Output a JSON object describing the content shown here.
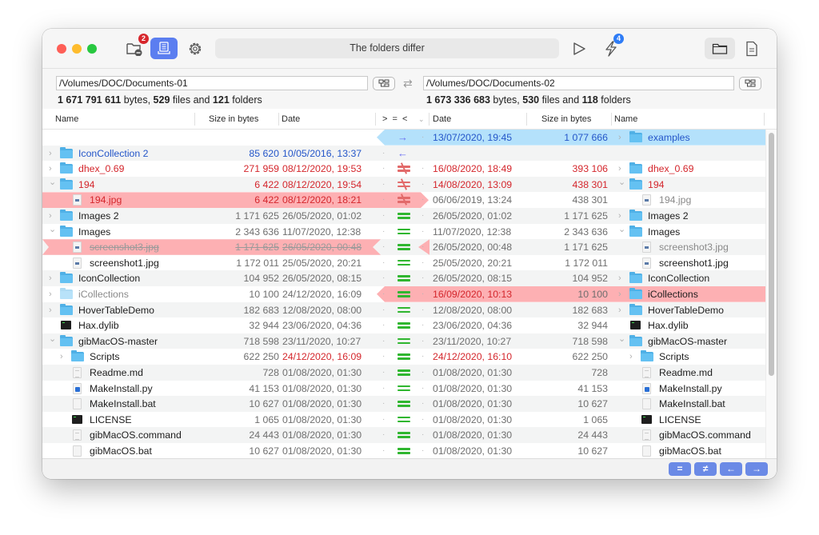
{
  "toolbar": {
    "status_text": "The folders differ",
    "badges": {
      "folder_badge": "2",
      "bolt_badge": "4"
    },
    "icons": [
      "folder-minus-icon",
      "document-compare-icon",
      "gear-icon",
      "play-icon",
      "bolt-icon",
      "folder-view-icon",
      "file-view-icon"
    ]
  },
  "left": {
    "path": "/Volumes/DOC/Documents-01",
    "bytes": "1 671 791 611",
    "files": "529",
    "folders": "121",
    "bytes_label": " bytes, ",
    "files_label": " files and ",
    "folders_label": " folders"
  },
  "right": {
    "path": "/Volumes/DOC/Documents-02",
    "bytes": "1 673 336 683",
    "files": "530",
    "folders": "118",
    "bytes_label": " bytes, ",
    "files_label": " files and ",
    "folders_label": " folders"
  },
  "columns": {
    "left_name": "Name",
    "left_size": "Size in bytes",
    "left_date": "Date",
    "compare": "> = <",
    "right_date": "Date",
    "right_size": "Size in bytes",
    "right_name": "Name"
  },
  "rows": [
    {
      "l_name": "",
      "l_size": "",
      "l_date": "",
      "cmp": "right",
      "r_date": "13/07/2020, 19:45",
      "r_size": "1 077 666",
      "r_name": "examples"
    },
    {
      "l_name": "IconCollection 2",
      "l_size": "85 620",
      "l_date": "10/05/2016, 13:37",
      "cmp": "left",
      "r_date": "",
      "r_size": "",
      "r_name": ""
    },
    {
      "l_name": "dhex_0.69",
      "l_size": "271 959",
      "l_date": "08/12/2020, 19:53",
      "cmp": "neq",
      "r_date": "16/08/2020, 18:49",
      "r_size": "393 106",
      "r_name": "dhex_0.69"
    },
    {
      "l_name": "194",
      "l_size": "6 422",
      "l_date": "08/12/2020, 19:54",
      "cmp": "neq",
      "r_date": "14/08/2020, 13:09",
      "r_size": "438 301",
      "r_name": "194"
    },
    {
      "l_name": "194.jpg",
      "l_size": "6 422",
      "l_date": "08/12/2020, 18:21",
      "cmp": "neq",
      "r_date": "06/06/2019, 13:24",
      "r_size": "438 301",
      "r_name": "194.jpg"
    },
    {
      "l_name": "Images 2",
      "l_size": "1 171 625",
      "l_date": "26/05/2020, 01:02",
      "cmp": "eq",
      "r_date": "26/05/2020, 01:02",
      "r_size": "1 171 625",
      "r_name": "Images 2"
    },
    {
      "l_name": "Images",
      "l_size": "2 343 636",
      "l_date": "11/07/2020, 12:38",
      "cmp": "eq",
      "r_date": "11/07/2020, 12:38",
      "r_size": "2 343 636",
      "r_name": "Images"
    },
    {
      "l_name": "screenshot3.jpg",
      "l_size": "1 171 625",
      "l_date": "26/05/2020, 00:48",
      "cmp": "eq",
      "r_date": "26/05/2020, 00:48",
      "r_size": "1 171 625",
      "r_name": "screenshot3.jpg"
    },
    {
      "l_name": "screenshot1.jpg",
      "l_size": "1 172 011",
      "l_date": "25/05/2020, 20:21",
      "cmp": "eq",
      "r_date": "25/05/2020, 20:21",
      "r_size": "1 172 011",
      "r_name": "screenshot1.jpg"
    },
    {
      "l_name": "IconCollection",
      "l_size": "104 952",
      "l_date": "26/05/2020, 08:15",
      "cmp": "eq",
      "r_date": "26/05/2020, 08:15",
      "r_size": "104 952",
      "r_name": "IconCollection"
    },
    {
      "l_name": "iCollections",
      "l_size": "10 100",
      "l_date": "24/12/2020, 16:09",
      "cmp": "eq",
      "r_date": "16/09/2020, 10:13",
      "r_size": "10 100",
      "r_name": "iCollections"
    },
    {
      "l_name": "HoverTableDemo",
      "l_size": "182 683",
      "l_date": "12/08/2020, 08:00",
      "cmp": "eq",
      "r_date": "12/08/2020, 08:00",
      "r_size": "182 683",
      "r_name": "HoverTableDemo"
    },
    {
      "l_name": "Hax.dylib",
      "l_size": "32 944",
      "l_date": "23/06/2020, 04:36",
      "cmp": "eq",
      "r_date": "23/06/2020, 04:36",
      "r_size": "32 944",
      "r_name": "Hax.dylib"
    },
    {
      "l_name": "gibMacOS-master",
      "l_size": "718 598",
      "l_date": "23/11/2020, 10:27",
      "cmp": "eq",
      "r_date": "23/11/2020, 10:27",
      "r_size": "718 598",
      "r_name": "gibMacOS-master"
    },
    {
      "l_name": "Scripts",
      "l_size": "622 250",
      "l_date": "24/12/2020, 16:09",
      "cmp": "eq",
      "r_date": "24/12/2020, 16:10",
      "r_size": "622 250",
      "r_name": "Scripts"
    },
    {
      "l_name": "Readme.md",
      "l_size": "728",
      "l_date": "01/08/2020, 01:30",
      "cmp": "eq",
      "r_date": "01/08/2020, 01:30",
      "r_size": "728",
      "r_name": "Readme.md"
    },
    {
      "l_name": "MakeInstall.py",
      "l_size": "41 153",
      "l_date": "01/08/2020, 01:30",
      "cmp": "eq",
      "r_date": "01/08/2020, 01:30",
      "r_size": "41 153",
      "r_name": "MakeInstall.py"
    },
    {
      "l_name": "MakeInstall.bat",
      "l_size": "10 627",
      "l_date": "01/08/2020, 01:30",
      "cmp": "eq",
      "r_date": "01/08/2020, 01:30",
      "r_size": "10 627",
      "r_name": "MakeInstall.bat"
    },
    {
      "l_name": "LICENSE",
      "l_size": "1 065",
      "l_date": "01/08/2020, 01:30",
      "cmp": "eq",
      "r_date": "01/08/2020, 01:30",
      "r_size": "1 065",
      "r_name": "LICENSE"
    },
    {
      "l_name": "gibMacOS.command",
      "l_size": "24 443",
      "l_date": "01/08/2020, 01:30",
      "cmp": "eq",
      "r_date": "01/08/2020, 01:30",
      "r_size": "24 443",
      "r_name": "gibMacOS.command"
    },
    {
      "l_name": "gibMacOS.bat",
      "l_size": "10 627",
      "l_date": "01/08/2020, 01:30",
      "cmp": "eq",
      "r_date": "01/08/2020, 01:30",
      "r_size": "10 627",
      "r_name": "gibMacOS.bat"
    }
  ],
  "bottom_buttons": [
    {
      "label": "=",
      "name": "show-equal-button"
    },
    {
      "label": "≠",
      "name": "show-different-button"
    },
    {
      "label": "←",
      "name": "show-left-only-button"
    },
    {
      "label": "→",
      "name": "show-right-only-button"
    }
  ],
  "colors": {
    "accent": "#5b7ef0",
    "diff_red": "#d4262c",
    "left_only_blue": "#2456c9",
    "equal_green": "#2fb62f",
    "highlight_red": "#fdb0b3",
    "highlight_blue": "#b4e1fb"
  }
}
